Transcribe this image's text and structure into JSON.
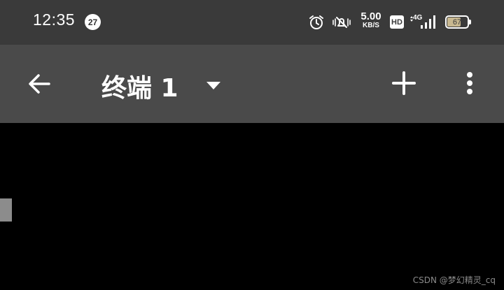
{
  "status_bar": {
    "time": "12:35",
    "notification_count": "27",
    "net_speed_value": "5.00",
    "net_speed_unit": "KB/S",
    "hd_label": "HD",
    "network_type": "4G",
    "battery_level": 67,
    "battery_label": "67",
    "icons": [
      "alarm-icon",
      "vibrate-mute-icon",
      "signal-icon"
    ]
  },
  "toolbar": {
    "title": "终端 1",
    "back_icon": "back-arrow-icon",
    "dropdown_icon": "caret-down-icon",
    "add_icon": "plus-icon",
    "more_icon": "more-vert-icon"
  },
  "terminal": {
    "background": "#000000",
    "cursor_color": "#8c8c8c"
  },
  "watermark": "CSDN @梦幻精灵_cq"
}
